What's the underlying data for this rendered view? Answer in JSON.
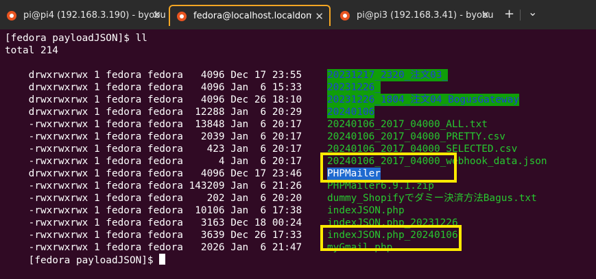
{
  "tabs": [
    {
      "label": "pi@pi4 (192.168.3.190) - byobu",
      "close": "✕"
    },
    {
      "label": "fedora@localhost.localdomain",
      "close": "✕"
    },
    {
      "label": "pi@pi3 (192.168.3.41) - byobu",
      "close": "✕"
    }
  ],
  "tabbar": {
    "new_tab": "+",
    "dropdown": "⌄"
  },
  "colors": {
    "highlight_box": "#ffea00",
    "active_tab_border": "#f5a623",
    "terminal_bg": "#300a24"
  },
  "terminal": {
    "prompt_command": "[fedora payloadJSON]$ ll",
    "total": "total 214",
    "rows": [
      {
        "meta": "drwxrwxrwx 1 fedora fedora   4096 Dec 17 23:55 ",
        "name": "20231217_2320_注文03_"
      },
      {
        "meta": "drwxrwxrwx 1 fedora fedora   4096 Jan  6 15:33 ",
        "name": "20231226_"
      },
      {
        "meta": "drwxrwxrwx 1 fedora fedora   4096 Dec 26 18:10 ",
        "name": "20231226_1804_注文04_BogusGateway"
      },
      {
        "meta": "drwxrwxrwx 1 fedora fedora  12288 Jan  6 20:29 ",
        "name": "20240106"
      },
      {
        "meta": "-rwxrwxrwx 1 fedora fedora  13848 Jan  6 20:17 ",
        "name": "20240106_2017_04000_ALL.txt"
      },
      {
        "meta": "-rwxrwxrwx 1 fedora fedora   2039 Jan  6 20:17 ",
        "name": "20240106_2017_04000_PRETTY.csv"
      },
      {
        "meta": "-rwxrwxrwx 1 fedora fedora    423 Jan  6 20:17 ",
        "name": "20240106_2017_04000_SELECTED.csv"
      },
      {
        "meta": "-rwxrwxrwx 1 fedora fedora      4 Jan  6 20:17 ",
        "name": "20240106_2017_04000_webhook_data.json"
      },
      {
        "meta": "drwxrwxrwx 1 fedora fedora   4096 Dec 17 23:46 ",
        "name": "PHPMailer"
      },
      {
        "meta": "-rwxrwxrwx 1 fedora fedora 143209 Jan  6 21:26 ",
        "name": "PHPMailer6.9.1.zip"
      },
      {
        "meta": "-rwxrwxrwx 1 fedora fedora    202 Jan  6 20:20 ",
        "name": "dummy_Shopifyでダミー決済方法Bagus.txt"
      },
      {
        "meta": "-rwxrwxrwx 1 fedora fedora  10106 Jan  6 17:38 ",
        "name": "indexJSON.php"
      },
      {
        "meta": "-rwxrwxrwx 1 fedora fedora   3163 Dec 18 00:24 ",
        "name": "indexJSON.php_20231226"
      },
      {
        "meta": "-rwxrwxrwx 1 fedora fedora   3639 Dec 26 17:33 ",
        "name": "indexJSON.php_20240106"
      },
      {
        "meta": "-rwxrwxrwx 1 fedora fedora   2026 Jan  6 21:47 ",
        "name": "myGmail.php"
      }
    ],
    "prompt_end": "[fedora payloadJSON]$ "
  }
}
